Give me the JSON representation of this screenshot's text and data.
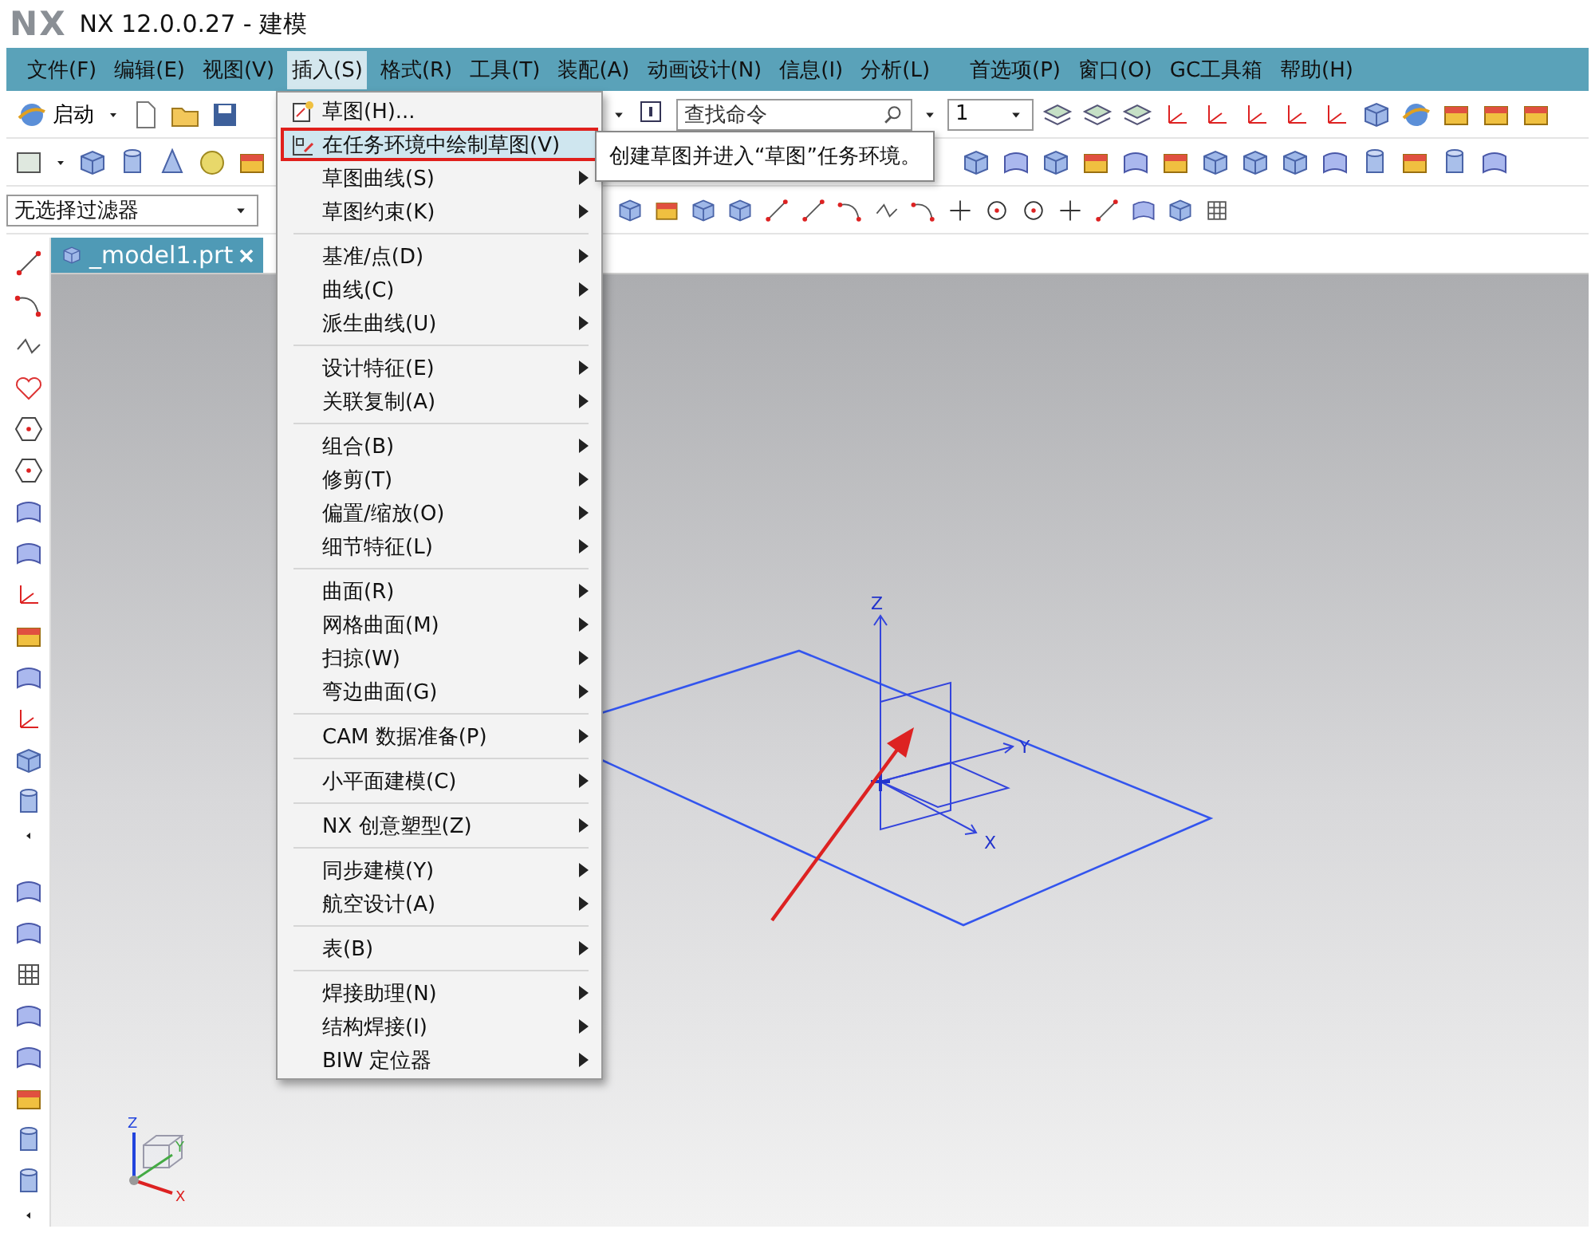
{
  "window": {
    "logo": "NX",
    "title": "NX 12.0.0.27 - 建模"
  },
  "menu_bar": [
    {
      "label": "文件(F)",
      "selected": false
    },
    {
      "label": "编辑(E)",
      "selected": false
    },
    {
      "label": "视图(V)",
      "selected": false
    },
    {
      "label": "插入(S)",
      "selected": true
    },
    {
      "label": "格式(R)",
      "selected": false
    },
    {
      "label": "工具(T)",
      "selected": false
    },
    {
      "label": "装配(A)",
      "selected": false
    },
    {
      "label": "动画设计(N)",
      "selected": false
    },
    {
      "label": "信息(I)",
      "selected": false
    },
    {
      "label": "分析(L)",
      "selected": false
    },
    {
      "label": "首选项(P)",
      "selected": false
    },
    {
      "label": "窗口(O)",
      "selected": false
    },
    {
      "label": "GC工具箱",
      "selected": false
    },
    {
      "label": "帮助(H)",
      "selected": false
    }
  ],
  "toolbar": {
    "start_button": "启动",
    "search": {
      "placeholder": "查找命令"
    },
    "layer": {
      "value": "1"
    },
    "selection_filter": {
      "value": "无选择过滤器"
    }
  },
  "document_tab": {
    "label": "_model1.prt"
  },
  "insert_menu": {
    "groups": [
      [
        {
          "label": "草图(H)...",
          "kind": "sketch",
          "submenu": false,
          "selected": false
        },
        {
          "label": "在任务环境中绘制草图(V)",
          "kind": "task-sketch",
          "submenu": false,
          "selected": true
        },
        {
          "label": "草图曲线(S)",
          "kind": "plain",
          "submenu": true,
          "selected": false
        },
        {
          "label": "草图约束(K)",
          "kind": "plain",
          "submenu": true,
          "selected": false
        }
      ],
      [
        {
          "label": "基准/点(D)",
          "kind": "plain",
          "submenu": true,
          "selected": false
        },
        {
          "label": "曲线(C)",
          "kind": "plain",
          "submenu": true,
          "selected": false
        },
        {
          "label": "派生曲线(U)",
          "kind": "plain",
          "submenu": true,
          "selected": false
        }
      ],
      [
        {
          "label": "设计特征(E)",
          "kind": "plain",
          "submenu": true,
          "selected": false
        },
        {
          "label": "关联复制(A)",
          "kind": "plain",
          "submenu": true,
          "selected": false
        }
      ],
      [
        {
          "label": "组合(B)",
          "kind": "plain",
          "submenu": true,
          "selected": false
        },
        {
          "label": "修剪(T)",
          "kind": "plain",
          "submenu": true,
          "selected": false
        },
        {
          "label": "偏置/缩放(O)",
          "kind": "plain",
          "submenu": true,
          "selected": false
        },
        {
          "label": "细节特征(L)",
          "kind": "plain",
          "submenu": true,
          "selected": false
        }
      ],
      [
        {
          "label": "曲面(R)",
          "kind": "plain",
          "submenu": true,
          "selected": false
        },
        {
          "label": "网格曲面(M)",
          "kind": "plain",
          "submenu": true,
          "selected": false
        },
        {
          "label": "扫掠(W)",
          "kind": "plain",
          "submenu": true,
          "selected": false
        },
        {
          "label": "弯边曲面(G)",
          "kind": "plain",
          "submenu": true,
          "selected": false
        }
      ],
      [
        {
          "label": "CAM 数据准备(P)",
          "kind": "plain",
          "submenu": true,
          "selected": false
        }
      ],
      [
        {
          "label": "小平面建模(C)",
          "kind": "plain",
          "submenu": true,
          "selected": false
        }
      ],
      [
        {
          "label": "NX 创意塑型(Z)",
          "kind": "plain",
          "submenu": true,
          "selected": false
        }
      ],
      [
        {
          "label": "同步建模(Y)",
          "kind": "plain",
          "submenu": true,
          "selected": false
        },
        {
          "label": "航空设计(A)",
          "kind": "plain",
          "submenu": true,
          "selected": false
        }
      ],
      [
        {
          "label": "表(B)",
          "kind": "plain",
          "submenu": true,
          "selected": false
        }
      ],
      [
        {
          "label": "焊接助理(N)",
          "kind": "plain",
          "submenu": true,
          "selected": false
        },
        {
          "label": "结构焊接(I)",
          "kind": "plain",
          "submenu": true,
          "selected": false
        },
        {
          "label": "BIW 定位器",
          "kind": "plain",
          "submenu": true,
          "selected": false
        }
      ]
    ]
  },
  "tooltip": "创建草图并进入“草图”任务环境。",
  "viewport": {
    "axis_labels": [
      "Z",
      "Y",
      "X"
    ],
    "triad_labels": [
      "Z",
      "Y",
      "X"
    ]
  }
}
